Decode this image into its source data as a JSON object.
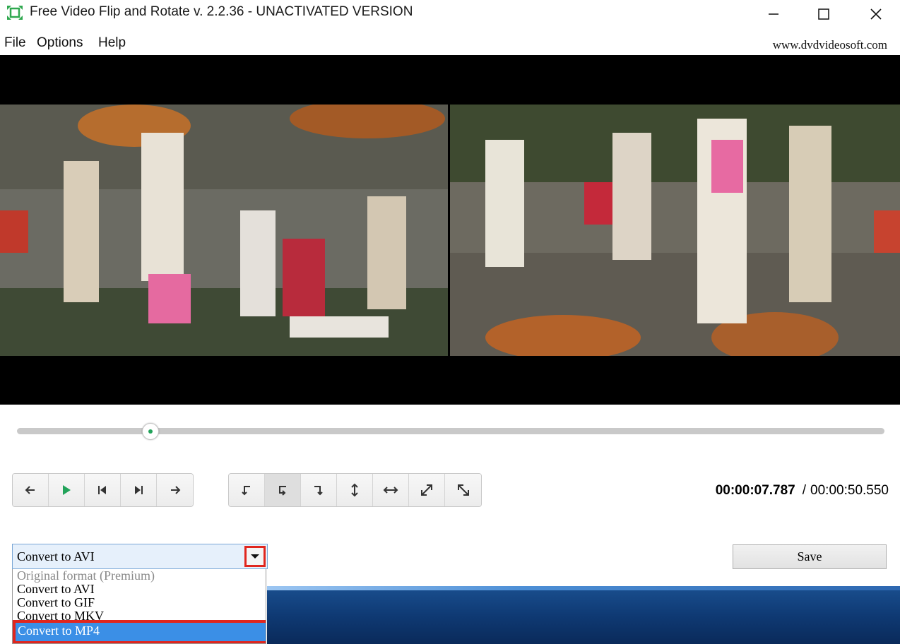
{
  "window": {
    "title": "Free Video Flip and Rotate v. 2.2.36 - UNACTIVATED VERSION"
  },
  "menu": {
    "file": "File",
    "options": "Options",
    "help": "Help"
  },
  "website": "www.dvdvideosoft.com",
  "playback": {
    "position_fraction": 0.154,
    "current_time": "00:00:07.787",
    "separator": "/",
    "total_time": "00:00:50.550"
  },
  "playback_buttons": [
    {
      "name": "back-icon"
    },
    {
      "name": "play-icon"
    },
    {
      "name": "previous-frame-icon"
    },
    {
      "name": "next-frame-icon"
    },
    {
      "name": "forward-icon"
    }
  ],
  "rotate_buttons": [
    {
      "name": "rotate-left-icon"
    },
    {
      "name": "rotate-left-flip-icon",
      "active": true
    },
    {
      "name": "rotate-right-icon"
    },
    {
      "name": "flip-vertical-icon"
    },
    {
      "name": "flip-horizontal-icon"
    },
    {
      "name": "transpose-icon"
    },
    {
      "name": "transverse-icon"
    }
  ],
  "format_select": {
    "selected": "Convert to AVI",
    "options": [
      {
        "label": "Original format (Premium)",
        "disabled": true
      },
      {
        "label": "Convert to AVI"
      },
      {
        "label": "Convert to GIF"
      },
      {
        "label": "Convert to MKV"
      },
      {
        "label": "Convert to MP4",
        "highlighted": true
      }
    ]
  },
  "save_label": "Save",
  "colors": {
    "accent_green": "#22a35a",
    "highlight_red": "#e0261e",
    "selection_blue": "#3b8fe6"
  }
}
